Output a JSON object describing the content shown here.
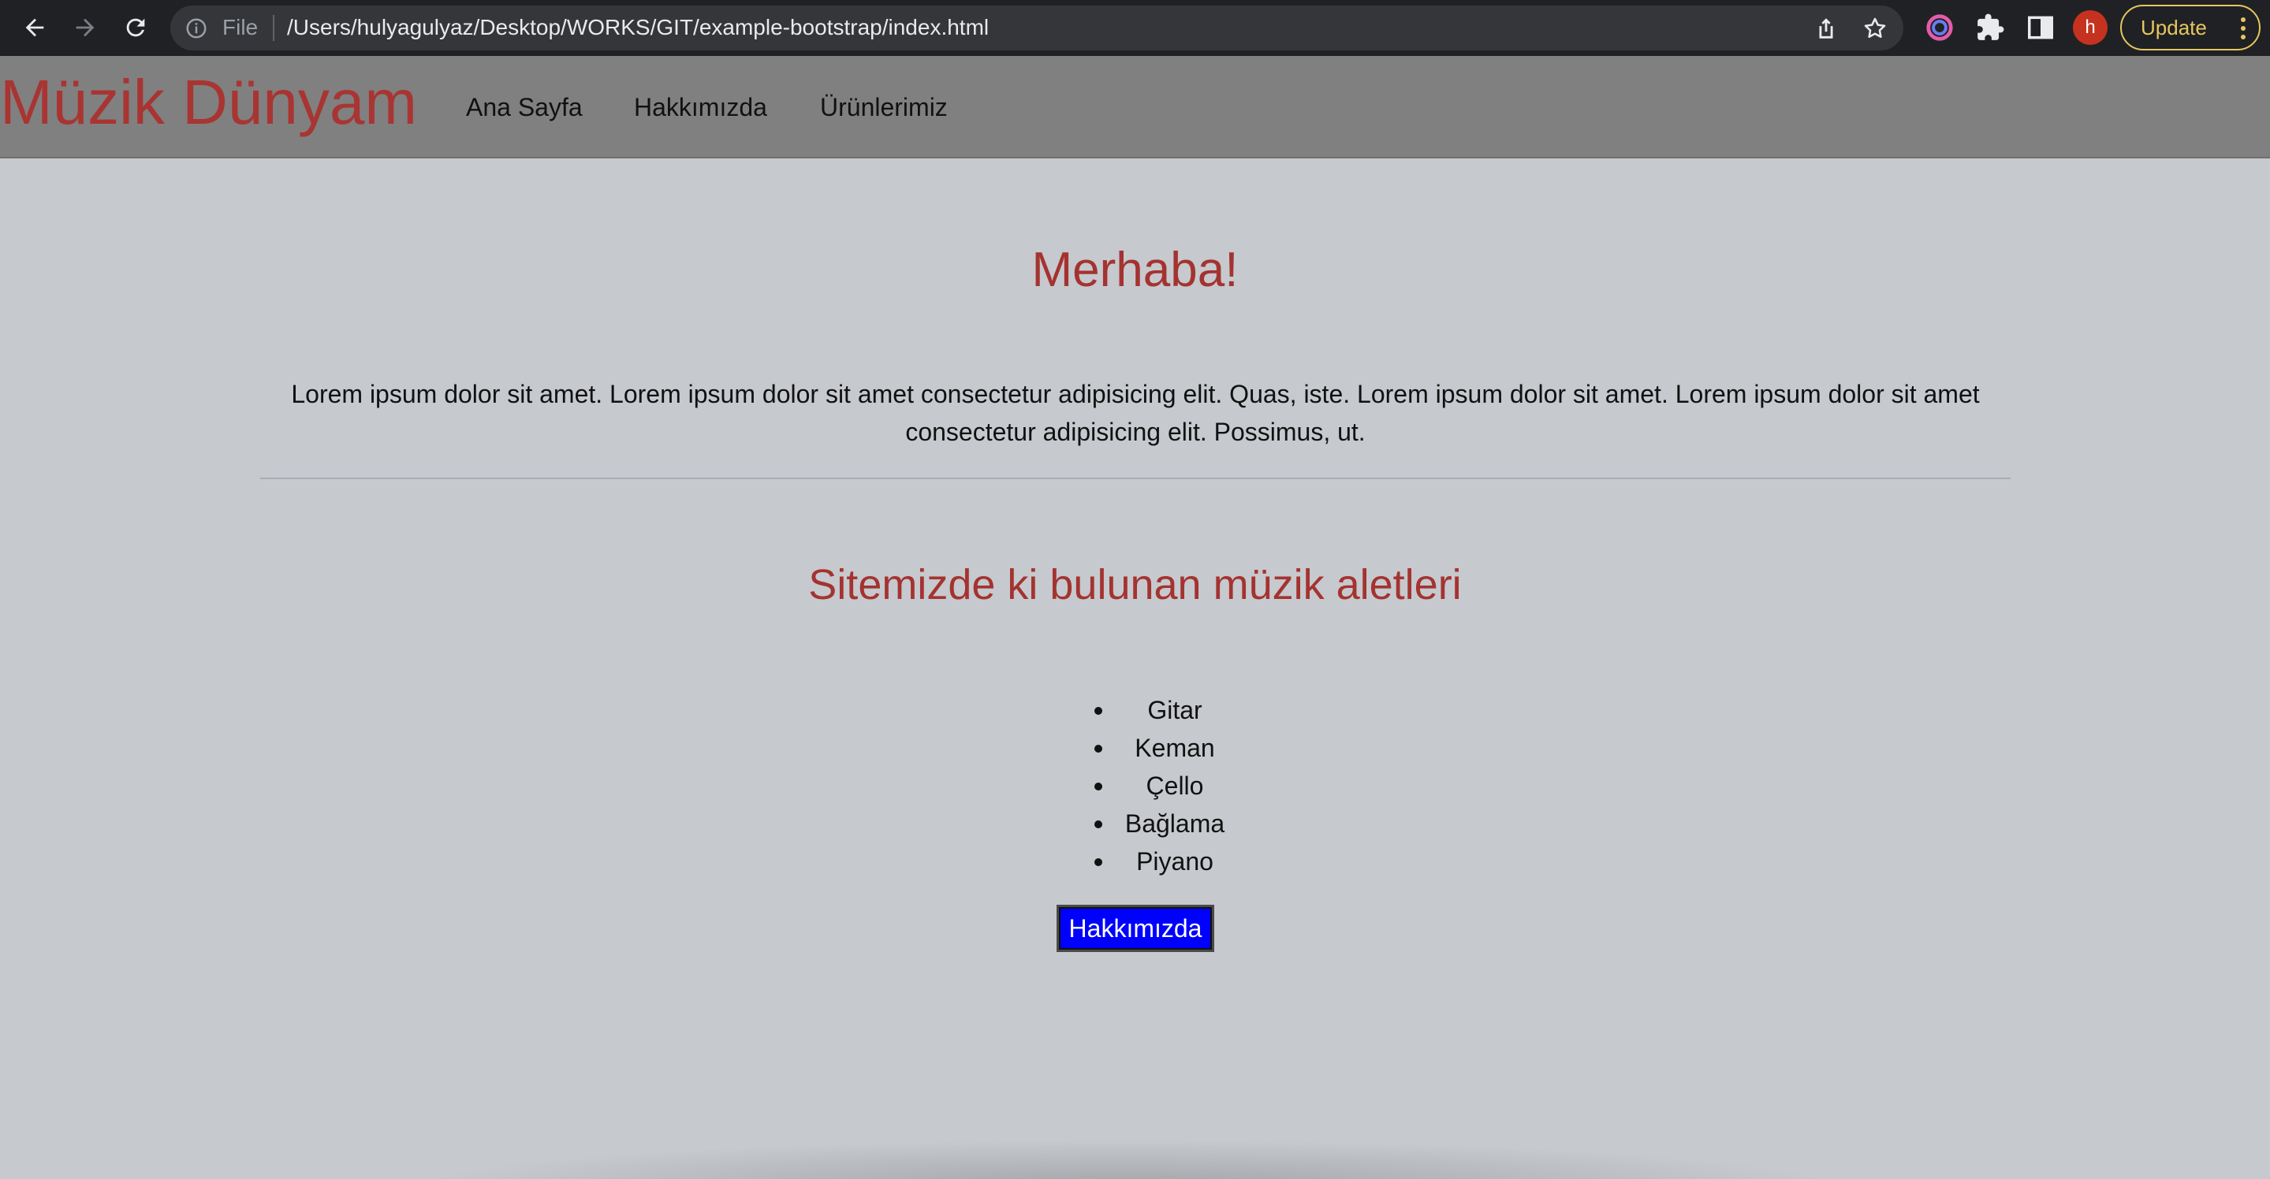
{
  "browser": {
    "omnibox_scheme_label": "File",
    "url": "/Users/hulyagulyaz/Desktop/WORKS/GIT/example-bootstrap/index.html",
    "profile_initial": "h",
    "update_label": "Update",
    "icons": [
      "back-icon",
      "forward-icon",
      "reload-icon",
      "info-icon",
      "share-icon",
      "star-icon",
      "extension-color-icon",
      "puzzle-icon",
      "side-panel-icon",
      "more-vert-icon"
    ],
    "accent_update": "#e6c75f",
    "avatar_color": "#c5321f"
  },
  "site": {
    "brand": "Müzik Dünyam",
    "nav": [
      {
        "label": "Ana Sayfa"
      },
      {
        "label": "Hakkımızda"
      },
      {
        "label": "Ürünlerimiz"
      }
    ],
    "hero_title": "Merhaba!",
    "lorem": "Lorem ipsum dolor sit amet. Lorem ipsum dolor sit amet consectetur adipisicing elit. Quas, iste. Lorem ipsum dolor sit amet. Lorem ipsum dolor sit amet consectetur adipisicing elit. Possimus, ut.",
    "instruments_title": "Sitemizde ki bulunan müzik aletleri",
    "instruments": [
      "Gitar",
      "Keman",
      "Çello",
      "Bağlama",
      "Piyano"
    ],
    "button_label": "Hakkımızda",
    "colors": {
      "heading": "#a43330",
      "navbar": "#808080",
      "background": "#c6c9ce",
      "button": "#0000ff"
    }
  }
}
